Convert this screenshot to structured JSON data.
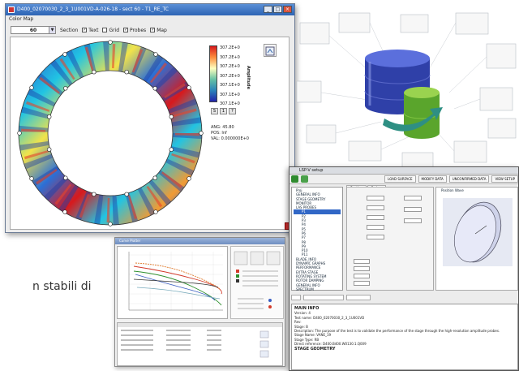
{
  "caption_fragment": "n stabili di",
  "colormap_window": {
    "title": "D400_02070030_2_3_1U001VD-A-026-18 - sect 60 - T1_RE_TC",
    "menu": "Color Map",
    "section_value": "60",
    "section_label": "Section",
    "checkboxes": [
      "Text",
      "Grid",
      "Probes",
      "Map"
    ],
    "checked": [
      true,
      false,
      true,
      true
    ],
    "scale_ticks": [
      "307.2E+0",
      "307.2E+0",
      "307.2E+0",
      "307.2E+0",
      "307.1E+0",
      "307.1E+0",
      "307.1E+0"
    ],
    "scale_label": "Amplitude",
    "readout": [
      "ANG: 45.80",
      "POS: Inf",
      "VAL: 0.000000E+0"
    ],
    "tool_labels": [
      "S",
      "1",
      "?"
    ]
  },
  "chart_window": {
    "title": "Curve Plotter"
  },
  "entry_window": {
    "title": "LSP-V setup",
    "toolbar_buttons": [
      "LOAD SURFACE",
      "MODIFY DATA",
      "UNCONFIRMED DATA",
      "VIEW SETUP"
    ],
    "tabs": [
      "Section",
      "Probes"
    ],
    "preview_title": "Position Wave",
    "tree_items": [
      "Proj",
      "GENERAL INFO",
      "STAGE GEOMETRY",
      "MONITOR",
      "LAS PROBES",
      "P1",
      "P2",
      "P3",
      "P4",
      "P5",
      "P6",
      "P7",
      "P8",
      "P9",
      "P10",
      "P11",
      "BLADE_INFO",
      "DYNAMIC GRAPHS",
      "PERFORMANCE",
      "EXTRA STAGE",
      "ROTATING SYSTEM",
      "ROTOR DAMPING",
      "GENERAL INFO",
      "SPECTRUM"
    ],
    "selected_index": 5,
    "info_heading": "MAIN INFO",
    "info_lines": [
      "Version: 4",
      "Test name: D400_02070030_2_3_1U001VD",
      "Rev:",
      "Stage: B",
      "Description: The purpose of the test is to validate the performance of the stage through the high-resolution amplitude probes.",
      "Stage Name: VANE_19",
      "Stage Type: RB",
      "Direct reference: D400.B400.W0130.1.Q009"
    ],
    "footer_heading": "STAGE GEOMETRY"
  }
}
